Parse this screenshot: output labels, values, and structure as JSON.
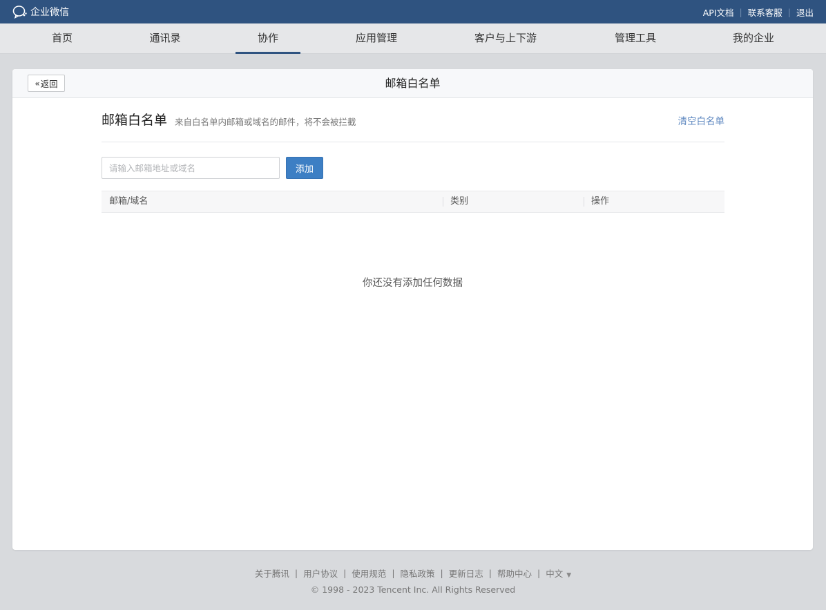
{
  "topbar": {
    "brand_name": "企业微信",
    "links": [
      "API文档",
      "联系客服",
      "退出"
    ]
  },
  "nav": {
    "items": [
      "首页",
      "通讯录",
      "协作",
      "应用管理",
      "客户与上下游",
      "管理工具",
      "我的企业"
    ],
    "active": "协作"
  },
  "card": {
    "back_label": "返回",
    "title": "邮箱白名单",
    "section_title": "邮箱白名单",
    "section_desc": "来自白名单内邮箱或域名的邮件，将不会被拦截",
    "clear_label": "清空白名单",
    "input_placeholder": "请输入邮箱地址或域名",
    "add_label": "添加",
    "table_headers": [
      "邮箱/域名",
      "类别",
      "操作"
    ],
    "empty_text": "你还没有添加任何数据"
  },
  "footer": {
    "links": [
      "关于腾讯",
      "用户协议",
      "使用规范",
      "隐私政策",
      "更新日志",
      "帮助中心"
    ],
    "language": "中文",
    "copyright": "© 1998 - 2023 Tencent Inc. All Rights Reserved"
  },
  "colors": {
    "topbar_bg": "#2f5380",
    "accent_button": "#3d7fc4",
    "link": "#5b86bf"
  }
}
